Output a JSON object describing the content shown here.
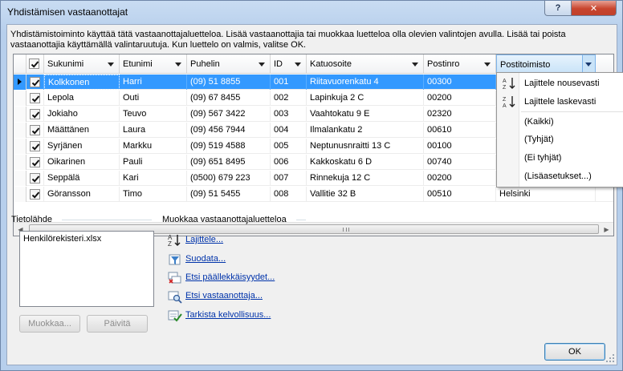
{
  "window": {
    "title": "Yhdistämisen vastaanottajat",
    "help_label": "?",
    "close_label": "✕"
  },
  "intro_text": "Yhdistämistoiminto käyttää tätä vastaanottajaluetteloa. Lisää vastaanottajia tai muokkaa luetteloa olla olevien valintojen avulla. Lisää tai poista vastaanottajia käyttämällä valintaruutuja. Kun luettelo on valmis, valitse OK.",
  "grid": {
    "columns": [
      "Sukunimi",
      "Etunimi",
      "Puhelin",
      "ID",
      "Katuosoite",
      "Postinro",
      "Postitoimisto"
    ],
    "rows": [
      {
        "checked": true,
        "sukunimi": "Kolkkonen",
        "etunimi": "Harri",
        "puhelin": "(09) 51 8855",
        "id": "001",
        "katuosoite": "Riitavuorenkatu 4",
        "postinro": "00300",
        "postitoimisto": ""
      },
      {
        "checked": true,
        "sukunimi": "Lepola",
        "etunimi": "Outi",
        "puhelin": "(09) 67 8455",
        "id": "002",
        "katuosoite": "Lapinkuja 2 C",
        "postinro": "00200",
        "postitoimisto": ""
      },
      {
        "checked": true,
        "sukunimi": "Jokiaho",
        "etunimi": "Teuvo",
        "puhelin": "(09) 567 3422",
        "id": "003",
        "katuosoite": "Vaahtokatu 9 E",
        "postinro": "02320",
        "postitoimisto": ""
      },
      {
        "checked": true,
        "sukunimi": "Määttänen",
        "etunimi": "Laura",
        "puhelin": "(09) 456 7944",
        "id": "004",
        "katuosoite": "Ilmalankatu 2",
        "postinro": "00610",
        "postitoimisto": ""
      },
      {
        "checked": true,
        "sukunimi": "Syrjänen",
        "etunimi": "Markku",
        "puhelin": "(09) 519 4588",
        "id": "005",
        "katuosoite": "Neptunusnraitti 13 C",
        "postinro": "00100",
        "postitoimisto": ""
      },
      {
        "checked": true,
        "sukunimi": "Oikarinen",
        "etunimi": "Pauli",
        "puhelin": "(09) 651 8495",
        "id": "006",
        "katuosoite": "Kakkoskatu 6 D",
        "postinro": "00740",
        "postitoimisto": ""
      },
      {
        "checked": true,
        "sukunimi": "Seppälä",
        "etunimi": "Kari",
        "puhelin": "(0500) 679 223",
        "id": "007",
        "katuosoite": "Rinnekuja 12 C",
        "postinro": "00200",
        "postitoimisto": ""
      },
      {
        "checked": true,
        "sukunimi": "Göransson",
        "etunimi": "Timo",
        "puhelin": "(09) 51 5455",
        "id": "008",
        "katuosoite": "Vallitie 32 B",
        "postinro": "00510",
        "postitoimisto": "Helsinki"
      }
    ]
  },
  "dropdown": {
    "sort_asc": "Lajittele nousevasti",
    "sort_desc": "Lajittele laskevasti",
    "all": "(Kaikki)",
    "empty": "(Tyhjät)",
    "not_empty": "(Ei tyhjät)",
    "advanced": "(Lisäasetukset...)"
  },
  "datasource": {
    "label": "Tietolähde",
    "file": "Henkilörekisteri.xlsx",
    "edit_button": "Muokkaa...",
    "refresh_button": "Päivitä"
  },
  "edit_list": {
    "label": "Muokkaa vastaanottajaluetteloa",
    "links": [
      "Lajittele...",
      "Suodata...",
      "Etsi päällekkäisyydet...",
      "Etsi vastaanottaja...",
      "Tarkista kelvollisuus..."
    ]
  },
  "ok_button": "OK"
}
